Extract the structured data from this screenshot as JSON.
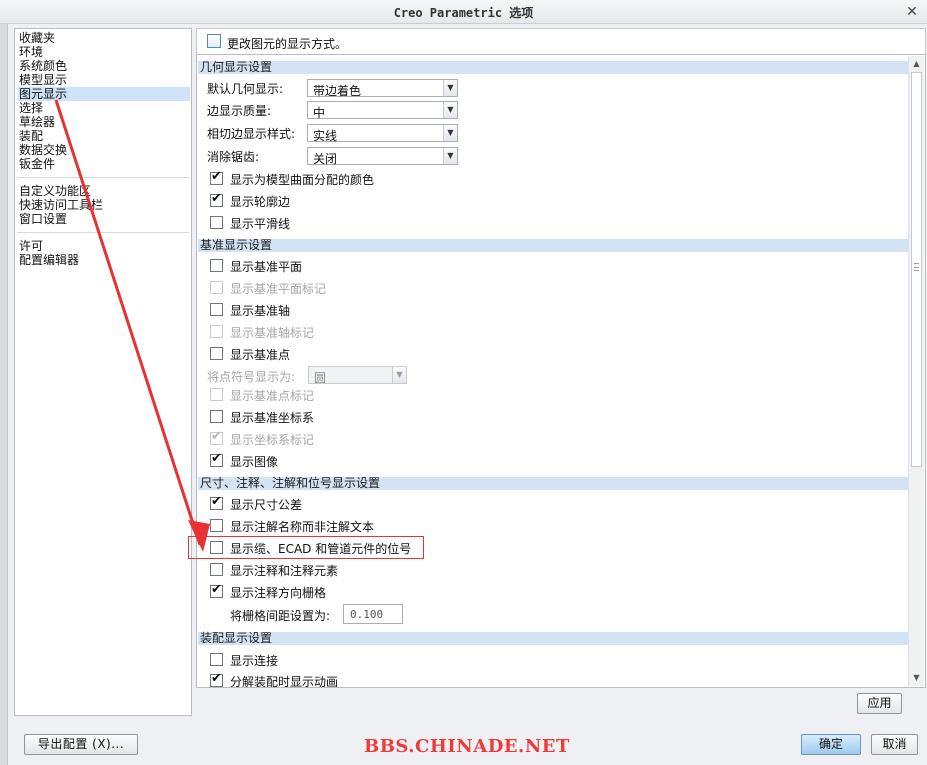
{
  "window": {
    "title": "Creo Parametric 选项",
    "close_glyph": "✕"
  },
  "nav": {
    "group1": [
      {
        "label": "收藏夹",
        "selected": false
      },
      {
        "label": "环境",
        "selected": false
      },
      {
        "label": "系统颜色",
        "selected": false
      },
      {
        "label": "模型显示",
        "selected": false
      },
      {
        "label": "图元显示",
        "selected": true
      },
      {
        "label": "选择",
        "selected": false
      },
      {
        "label": "草绘器",
        "selected": false
      },
      {
        "label": "装配",
        "selected": false
      },
      {
        "label": "数据交换",
        "selected": false
      },
      {
        "label": "钣金件",
        "selected": false
      }
    ],
    "group2": [
      {
        "label": "自定义功能区"
      },
      {
        "label": "快速访问工具栏"
      },
      {
        "label": "窗口设置"
      }
    ],
    "group3": [
      {
        "label": "许可"
      },
      {
        "label": "配置编辑器"
      }
    ]
  },
  "content": {
    "header": "更改图元的显示方式。",
    "geometry": {
      "title": "几何显示设置",
      "default_display": {
        "label": "默认几何显示:",
        "value": "带边着色"
      },
      "edge_quality": {
        "label": "边显示质量:",
        "value": "中"
      },
      "tangent_style": {
        "label": "相切边显示样式:",
        "value": "实线"
      },
      "antialias": {
        "label": "消除锯齿:",
        "value": "关闭"
      },
      "checks": [
        {
          "label": "显示为模型曲面分配的颜色",
          "checked": true,
          "disabled": false
        },
        {
          "label": "显示轮廓边",
          "checked": true,
          "disabled": false
        },
        {
          "label": "显示平滑线",
          "checked": false,
          "disabled": false
        }
      ]
    },
    "datum": {
      "title": "基准显示设置",
      "checks_a": [
        {
          "label": "显示基准平面",
          "checked": false,
          "disabled": false
        },
        {
          "label": "显示基准平面标记",
          "checked": false,
          "disabled": true
        },
        {
          "label": "显示基准轴",
          "checked": false,
          "disabled": false
        },
        {
          "label": "显示基准轴标记",
          "checked": false,
          "disabled": true
        },
        {
          "label": "显示基准点",
          "checked": false,
          "disabled": false
        }
      ],
      "point_symbol": {
        "label": "将点符号显示为:",
        "value": "圆"
      },
      "checks_b": [
        {
          "label": "显示基准点标记",
          "checked": false,
          "disabled": true
        },
        {
          "label": "显示基准坐标系",
          "checked": false,
          "disabled": false
        },
        {
          "label": "显示坐标系标记",
          "checked": true,
          "disabled": true
        },
        {
          "label": "显示图像",
          "checked": true,
          "disabled": false
        }
      ]
    },
    "dimension": {
      "title": "尺寸、注释、注解和位号显示设置",
      "checks": [
        {
          "label": "显示尺寸公差",
          "checked": true,
          "disabled": false
        },
        {
          "label": "显示注解名称而非注解文本",
          "checked": false,
          "disabled": false
        },
        {
          "label": "显示缆、ECAD 和管道元件的位号",
          "checked": false,
          "disabled": false
        },
        {
          "label": "显示注释和注释元素",
          "checked": false,
          "disabled": false
        },
        {
          "label": "显示注释方向栅格",
          "checked": true,
          "disabled": false
        }
      ],
      "grid_spacing": {
        "label": "将栅格间距设置为:",
        "value": "0.100"
      }
    },
    "assembly": {
      "title": "装配显示设置",
      "checks": [
        {
          "label": "显示连接",
          "checked": false,
          "disabled": false
        },
        {
          "label": "分解装配时显示动画",
          "checked": true,
          "disabled": false
        }
      ]
    }
  },
  "buttons": {
    "apply": "应用",
    "export": "导出配置 (X)...",
    "ok": "确定",
    "cancel": "取消"
  },
  "watermark": "BBS.CHINADE.NET",
  "colors": {
    "section_bg": "#d4e3f4",
    "selected_bg": "#cfe3f8",
    "annotation_red": "#ef3a3a"
  }
}
